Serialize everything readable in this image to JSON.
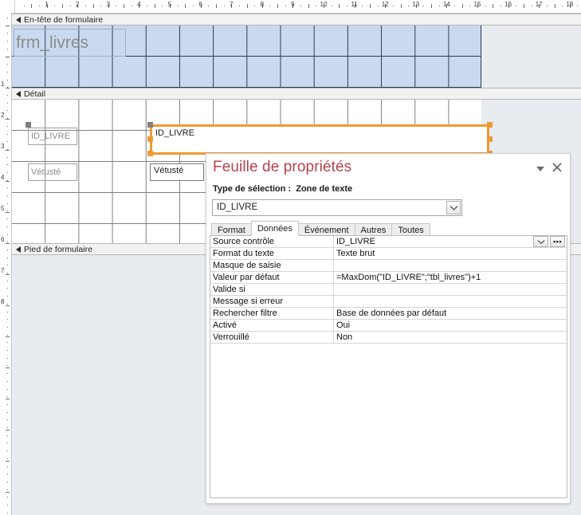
{
  "ruler": {
    "horizontal_numbers": [
      1,
      2,
      3,
      4,
      5,
      6,
      7,
      8,
      9,
      10,
      11,
      12,
      13,
      14,
      15,
      16,
      17,
      18
    ],
    "vertical_numbers": [
      1,
      2,
      3,
      4,
      5,
      6,
      7,
      8
    ]
  },
  "form_design": {
    "sections": [
      {
        "name": "form-header",
        "label": "En-tête de formulaire"
      },
      {
        "name": "detail",
        "label": "Détail"
      },
      {
        "name": "form-footer",
        "label": "Pied de formulaire"
      }
    ],
    "controls": {
      "title_label": "frm_livres",
      "id_livre_label": "ID_LIVRE",
      "id_livre_textbox": "ID_LIVRE",
      "vetuste_label": "Vétusté",
      "vetuste_textbox": "Vétusté"
    }
  },
  "property_sheet": {
    "title": "Feuille de propriétés",
    "selection_type_label": "Type de sélection :",
    "selection_type_value": "Zone de texte",
    "selected_object": "ID_LIVRE",
    "collapse_icon": "chevron-down-icon",
    "close_icon": "close-icon",
    "combo_icon": "chevron-down-icon",
    "tabs": [
      {
        "label": "Format",
        "active": false
      },
      {
        "label": "Données",
        "active": true
      },
      {
        "label": "Événement",
        "active": false
      },
      {
        "label": "Autres",
        "active": false
      },
      {
        "label": "Toutes",
        "active": false
      }
    ],
    "properties": [
      {
        "name": "Source contrôle",
        "value": "ID_LIVRE",
        "buttons": true
      },
      {
        "name": "Format du texte",
        "value": "Texte brut",
        "buttons": false
      },
      {
        "name": "Masque de saisie",
        "value": "",
        "buttons": false
      },
      {
        "name": "Valeur par défaut",
        "value": "=MaxDom(\"ID_LIVRE\";\"tbl_livres\")+1",
        "buttons": false
      },
      {
        "name": "Valide si",
        "value": "",
        "buttons": false
      },
      {
        "name": "Message si erreur",
        "value": "",
        "buttons": false
      },
      {
        "name": "Rechercher filtre",
        "value": "Base de données par défaut",
        "buttons": false
      },
      {
        "name": "Activé",
        "value": "Oui",
        "buttons": false
      },
      {
        "name": "Verrouillé",
        "value": "Non",
        "buttons": false
      }
    ],
    "builder_button_label": "…"
  },
  "colors": {
    "title_accent": "#b5424f",
    "selection_orange": "#ee9b33",
    "header_section_blue": "#c9d9ef",
    "canvas_gray": "#e8ebf0"
  }
}
